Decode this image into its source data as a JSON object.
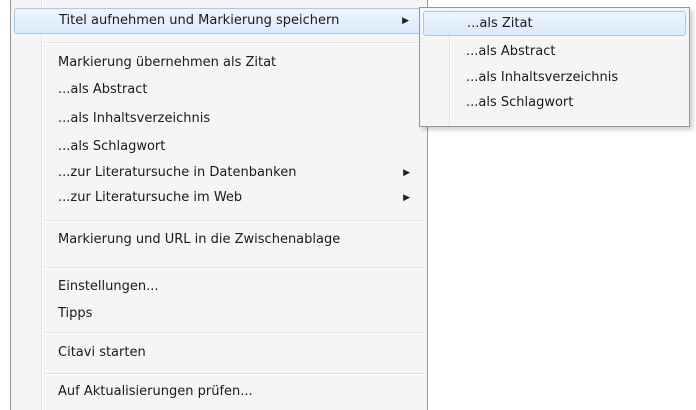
{
  "main_menu": {
    "items": [
      {
        "label": "Titel aufnehmen und Markierung speichern",
        "arrow": "▶"
      },
      {
        "label": "Markierung übernehmen als Zitat"
      },
      {
        "label": "...als Abstract"
      },
      {
        "label": "...als Inhaltsverzeichnis"
      },
      {
        "label": "...als Schlagwort"
      },
      {
        "label": "...zur Literatursuche in Datenbanken",
        "arrow": "▶"
      },
      {
        "label": "...zur Literatursuche im Web",
        "arrow": "▶"
      },
      {
        "label": "Markierung und URL in die Zwischenablage"
      },
      {
        "label": "Einstellungen..."
      },
      {
        "label": "Tipps"
      },
      {
        "label": "Citavi starten"
      },
      {
        "label": "Auf Aktualisierungen prüfen..."
      }
    ]
  },
  "sub_menu": {
    "items": [
      {
        "label": "...als Zitat"
      },
      {
        "label": "...als Abstract"
      },
      {
        "label": "...als Inhaltsverzeichnis"
      },
      {
        "label": "...als Schlagwort"
      }
    ]
  },
  "colors": {
    "highlight_border": "#a8c9ee",
    "highlight_fill": "#dbeafb",
    "menu_background": "#f5f5f5"
  }
}
